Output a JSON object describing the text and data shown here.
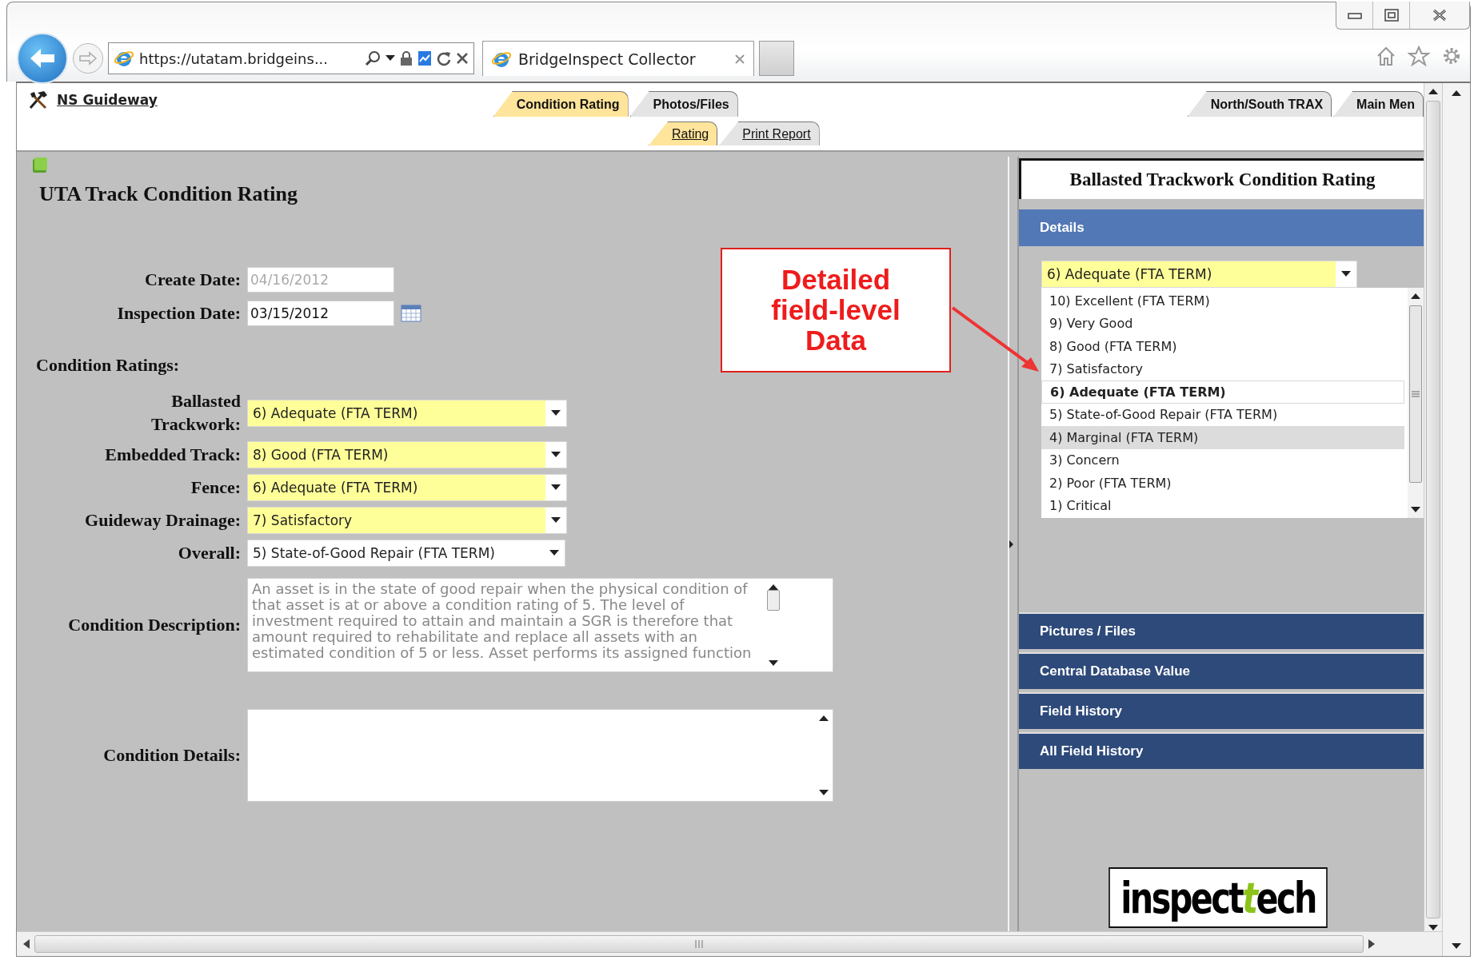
{
  "browser": {
    "address": "https://utatam.bridgeins...",
    "tab_title": "BridgeInspect Collector"
  },
  "header": {
    "asset_link": "NS Guideway",
    "tabs": [
      {
        "label": "Condition Rating",
        "selected": true
      },
      {
        "label": "Photos/Files",
        "selected": false
      }
    ],
    "subtabs": [
      {
        "label": "Rating",
        "selected": true
      },
      {
        "label": "Print Report",
        "selected": false
      }
    ],
    "nav_tabs": [
      {
        "label": "North/South TRAX",
        "selected": false
      },
      {
        "label": "Main Men",
        "selected": false
      }
    ]
  },
  "form": {
    "title": "UTA Track Condition Rating",
    "create_date": {
      "label": "Create Date:",
      "value": "04/16/2012",
      "disabled": true
    },
    "inspection_date": {
      "label": "Inspection Date:",
      "value": "03/15/2012",
      "disabled": false
    },
    "section_label": "Condition Ratings:",
    "ratings": [
      {
        "label": "Ballasted Trackwork:",
        "value": "6) Adequate (FTA TERM)",
        "highlighted": true
      },
      {
        "label": "Embedded Track:",
        "value": "8) Good (FTA TERM)",
        "highlighted": true
      },
      {
        "label": "Fence:",
        "value": "6) Adequate (FTA TERM)",
        "highlighted": true
      },
      {
        "label": "Guideway Drainage:",
        "value": "7) Satisfactory",
        "highlighted": true
      },
      {
        "label": "Overall:",
        "value": "5) State-of-Good Repair (FTA TERM)",
        "highlighted": false
      }
    ],
    "description": {
      "label": "Condition Description:",
      "value": "An asset is in the state of good repair when the physical condition of that asset is at or above a condition rating of 5. The level of investment required to attain and maintain a SGR is therefore that amount required to rehabilitate and replace all assets with an estimated condition of 5 or less. Asset performs its assigned function"
    },
    "details": {
      "label": "Condition Details:"
    }
  },
  "callout": {
    "text": "Detailed field-level Data"
  },
  "details_panel": {
    "title": "Ballasted Trackwork Condition Rating",
    "sections": [
      {
        "label": "Details",
        "expanded": true
      },
      {
        "label": "Pictures / Files",
        "expanded": false
      },
      {
        "label": "Central Database Value",
        "expanded": false
      },
      {
        "label": "Field History",
        "expanded": false
      },
      {
        "label": "All Field History",
        "expanded": false
      }
    ],
    "value": "6) Adequate (FTA TERM)",
    "options": [
      {
        "label": "10) Excellent (FTA TERM)",
        "selected": false,
        "hovered": false
      },
      {
        "label": "9) Very Good",
        "selected": false,
        "hovered": false
      },
      {
        "label": "8) Good (FTA TERM)",
        "selected": false,
        "hovered": false
      },
      {
        "label": "7) Satisfactory",
        "selected": false,
        "hovered": false
      },
      {
        "label": "6) Adequate (FTA TERM)",
        "selected": true,
        "hovered": false
      },
      {
        "label": "5) State-of-Good Repair (FTA TERM)",
        "selected": false,
        "hovered": false
      },
      {
        "label": "4) Marginal (FTA TERM)",
        "selected": false,
        "hovered": true
      },
      {
        "label": "3) Concern",
        "selected": false,
        "hovered": false
      },
      {
        "label": "2) Poor (FTA TERM)",
        "selected": false,
        "hovered": false
      },
      {
        "label": "1) Critical",
        "selected": false,
        "hovered": false
      }
    ],
    "logo": [
      {
        "text": "inspect",
        "accent": false
      },
      {
        "text": "t",
        "accent": true
      },
      {
        "text": "ech",
        "accent": false
      }
    ]
  }
}
